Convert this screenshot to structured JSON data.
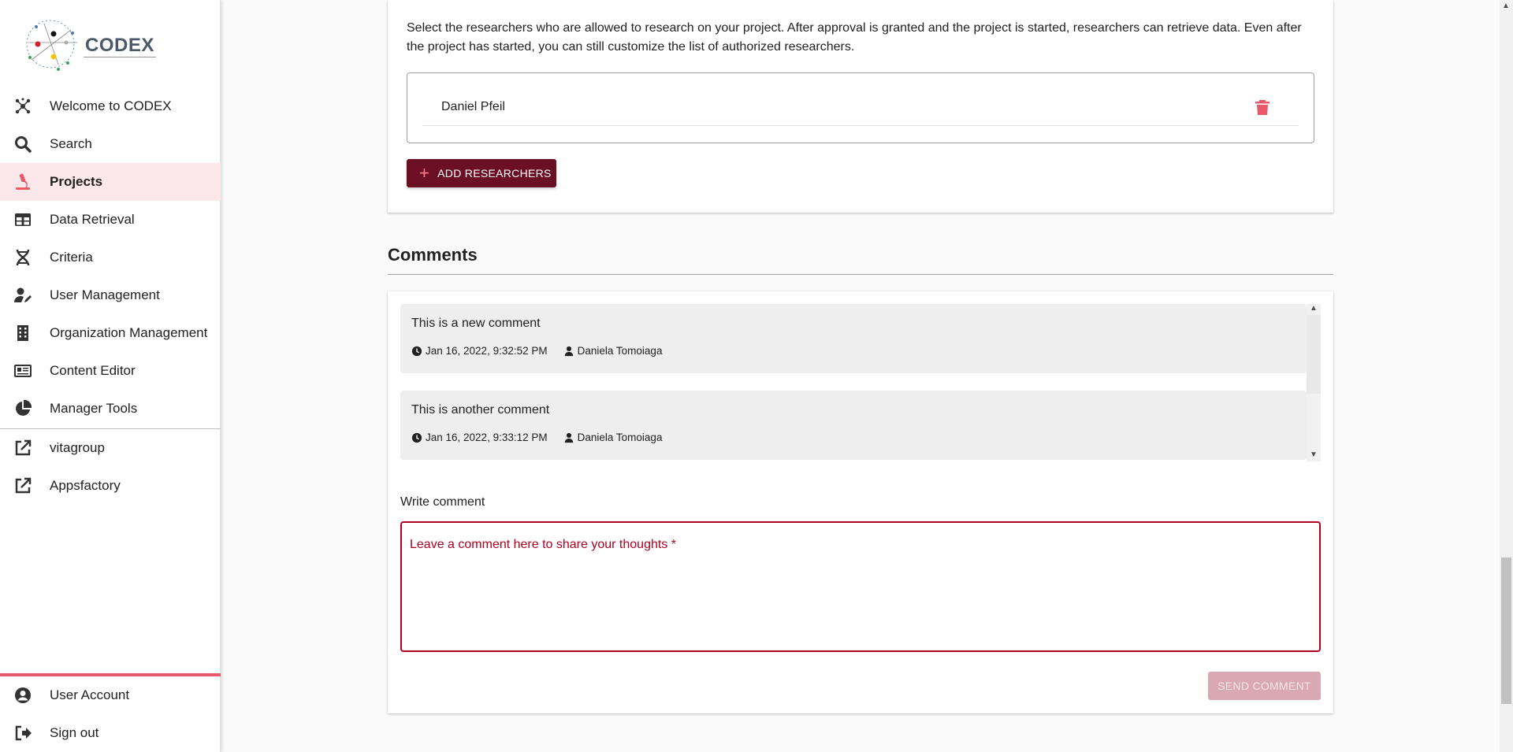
{
  "app": {
    "logo_text": "CODEX"
  },
  "sidebar": {
    "items": [
      {
        "label": "Welcome to CODEX",
        "icon": "molecule-icon"
      },
      {
        "label": "Search",
        "icon": "search-icon"
      },
      {
        "label": "Projects",
        "icon": "microscope-icon",
        "active": true
      },
      {
        "label": "Data Retrieval",
        "icon": "table-icon"
      },
      {
        "label": "Criteria",
        "icon": "dna-icon"
      },
      {
        "label": "User Management",
        "icon": "user-edit-icon"
      },
      {
        "label": "Organization Management",
        "icon": "building-icon"
      },
      {
        "label": "Content Editor",
        "icon": "newspaper-icon"
      },
      {
        "label": "Manager Tools",
        "icon": "pie-chart-icon"
      }
    ],
    "links": [
      {
        "label": "vitagroup",
        "icon": "external-link-icon"
      },
      {
        "label": "Appsfactory",
        "icon": "external-link-icon"
      }
    ],
    "bottom": [
      {
        "label": "User Account",
        "icon": "account-circle-icon"
      },
      {
        "label": "Sign out",
        "icon": "sign-out-icon"
      }
    ]
  },
  "researchers": {
    "intro": "Select the researchers who are allowed to research on your project. After approval is granted and the project is started, researchers can retrieve data. Even after the project has started, you can still customize the list of authorized researchers.",
    "list": [
      {
        "name": "Daniel Pfeil"
      }
    ],
    "add_button": "ADD RESEARCHERS"
  },
  "comments": {
    "title": "Comments",
    "items": [
      {
        "text": "This is a new comment",
        "date": "Jan 16, 2022, 9:32:52 PM",
        "author": "Daniela Tomoiaga"
      },
      {
        "text": "This is another comment",
        "date": "Jan 16, 2022, 9:33:12 PM",
        "author": "Daniela Tomoiaga"
      }
    ],
    "write_label": "Write comment",
    "placeholder": "Leave a comment here to share your thoughts *",
    "send_button": "SEND COMMENT"
  },
  "colors": {
    "brand": "#6b0f25",
    "accent": "#e85a6a",
    "error": "#b00020",
    "active_bg": "#fce8ea"
  }
}
